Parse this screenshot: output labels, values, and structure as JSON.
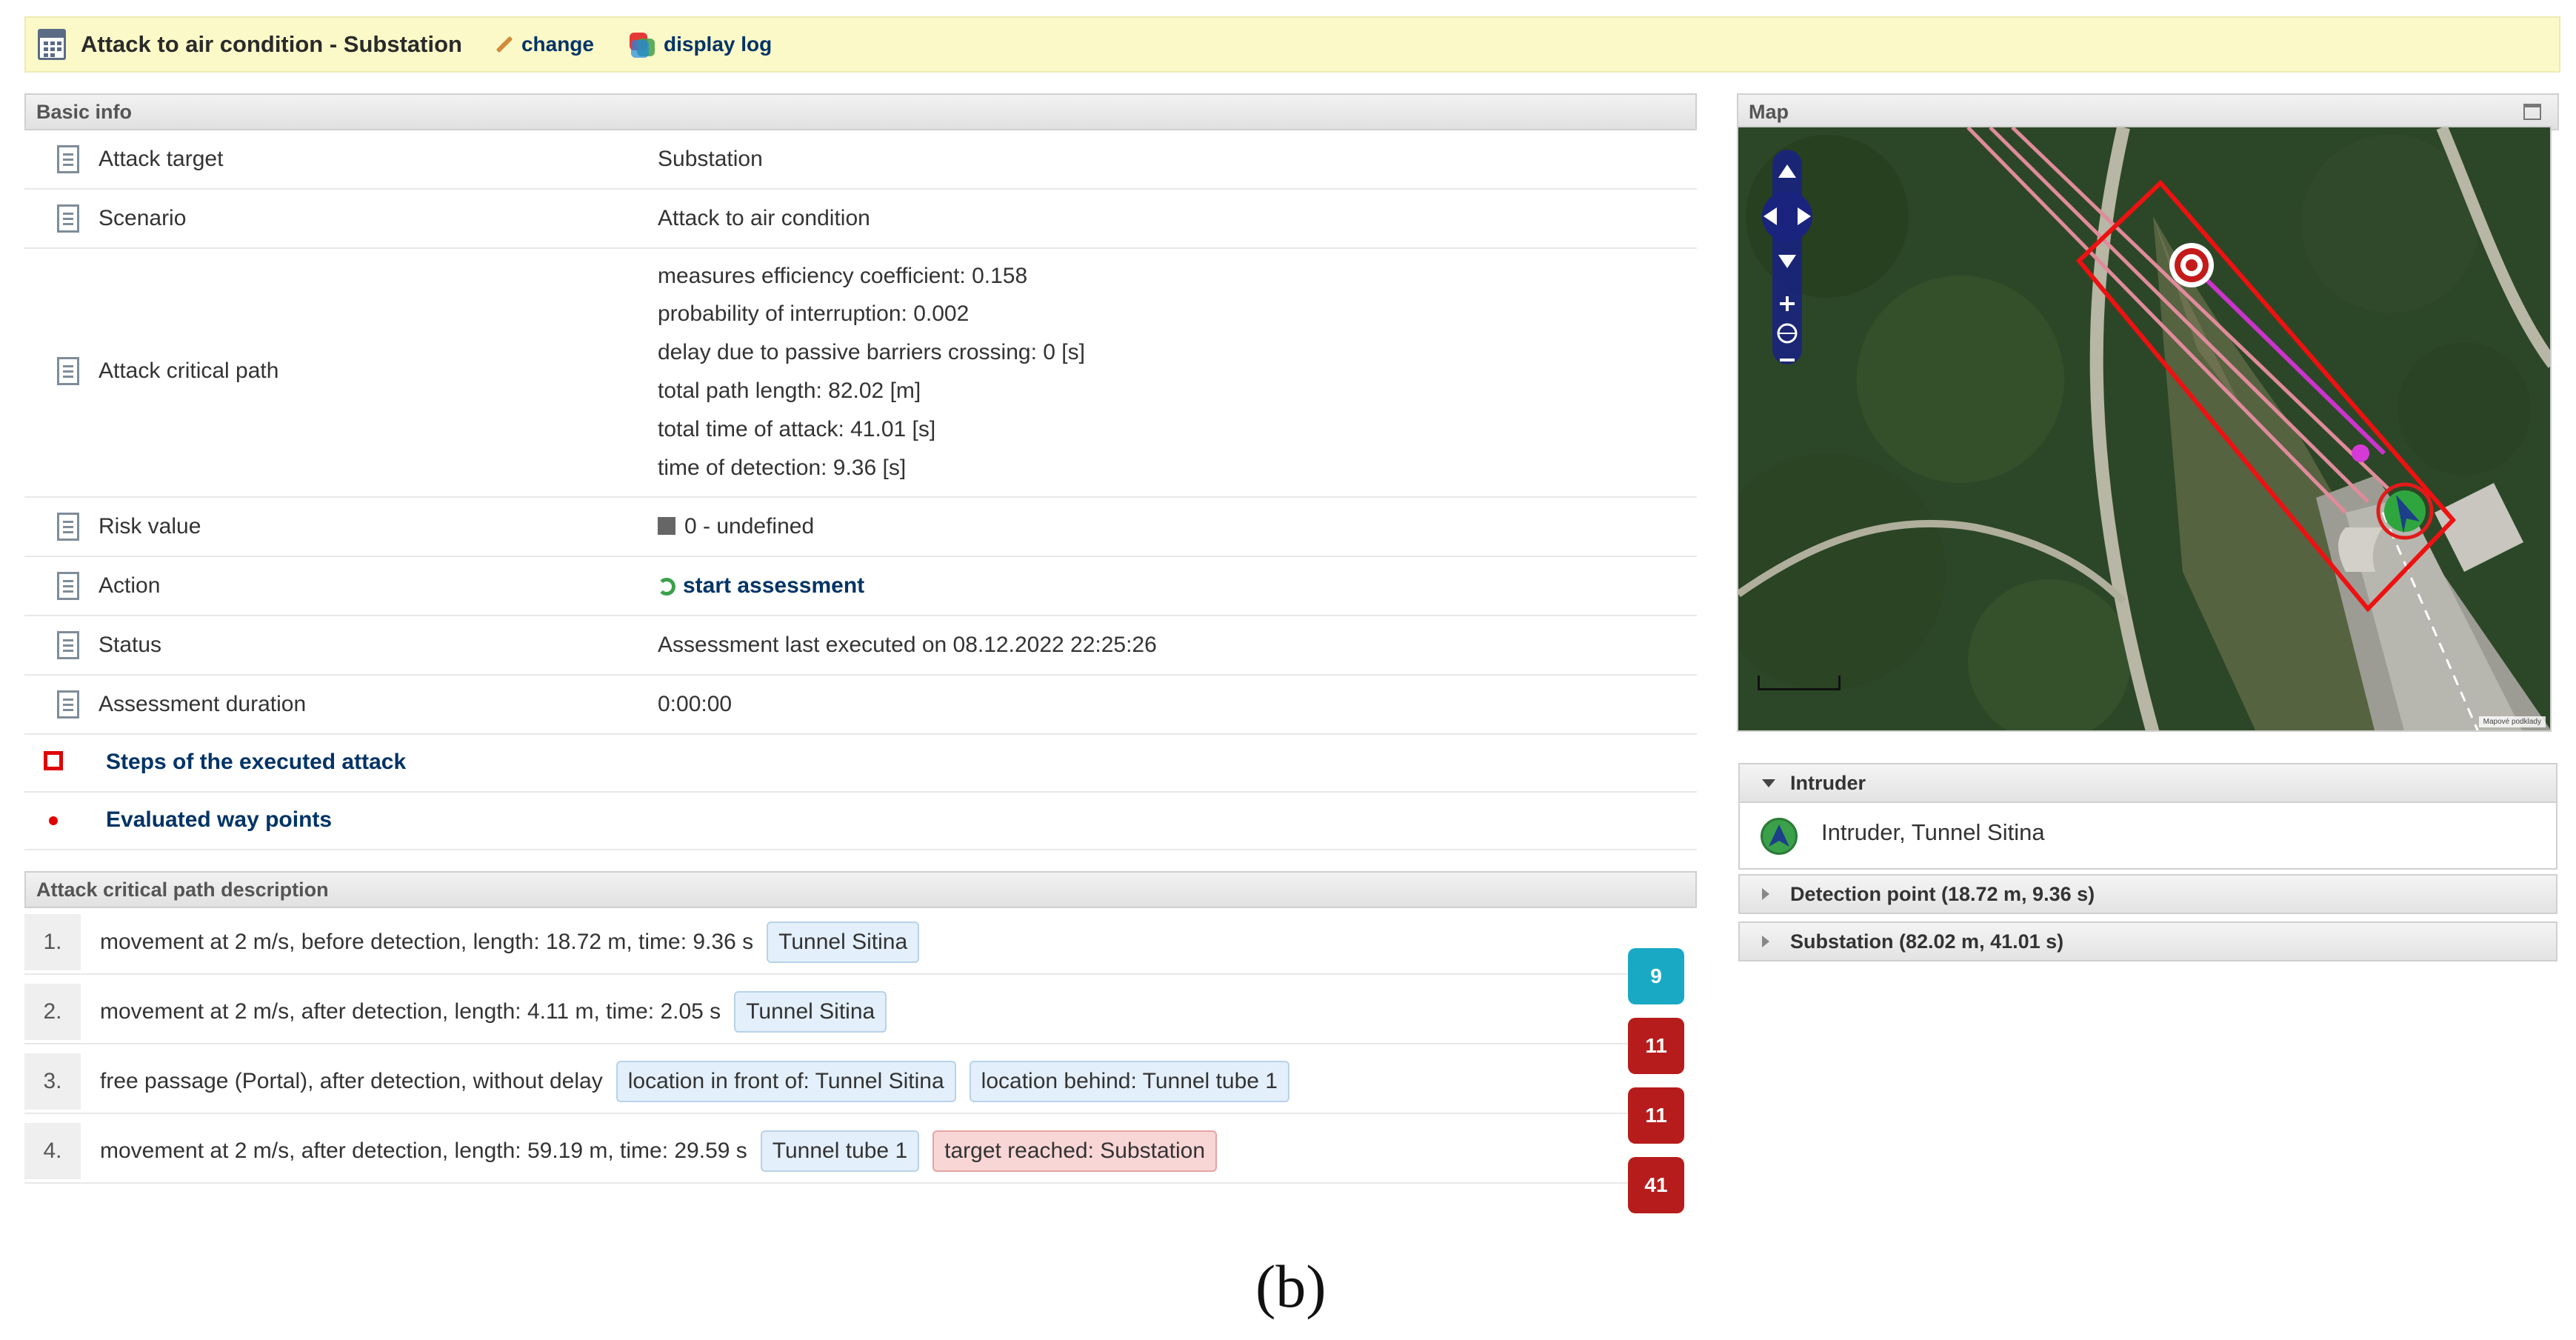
{
  "header": {
    "title": "Attack to air condition - Substation",
    "change_label": "change",
    "display_log_label": "display log"
  },
  "basic_info": {
    "heading": "Basic info",
    "rows": [
      {
        "label": "Attack target",
        "value": "Substation"
      },
      {
        "label": "Scenario",
        "value": "Attack to air condition"
      },
      {
        "label": "Attack critical path",
        "lines": [
          "measures efficiency coefficient: 0.158",
          "probability of interruption: 0.002",
          "delay due to passive barriers crossing: 0 [s]",
          "total path length: 82.02 [m]",
          "total time of attack: 41.01 [s]",
          "time of detection: 9.36 [s]"
        ]
      },
      {
        "label": "Risk value",
        "value": "0 - undefined"
      },
      {
        "label": "Action",
        "value": "start assessment"
      },
      {
        "label": "Status",
        "value": "Assessment last executed on 08.12.2022 22:25:26"
      },
      {
        "label": "Assessment duration",
        "value": "0:00:00"
      }
    ],
    "toggles": [
      "Steps of the executed attack",
      "Evaluated way points"
    ]
  },
  "critical_path": {
    "heading": "Attack critical path description",
    "steps": [
      {
        "num": "1.",
        "text": "movement at 2 m/s, before detection, length: 18.72 m, time: 9.36 s",
        "tags": [
          "Tunnel Sitina"
        ]
      },
      {
        "num": "2.",
        "text": "movement at 2 m/s, after detection, length: 4.11 m, time: 2.05 s",
        "tags": [
          "Tunnel Sitina"
        ]
      },
      {
        "num": "3.",
        "text": "free passage (Portal), after detection, without delay",
        "tags": [
          "location in front of: Tunnel Sitina",
          "location behind: Tunnel tube 1"
        ]
      },
      {
        "num": "4.",
        "text": "movement at 2 m/s, after detection, length: 59.19 m, time: 29.59 s",
        "tags": [
          "Tunnel tube 1"
        ],
        "target_tag": "target reached: Substation"
      }
    ],
    "badges": [
      {
        "value": "9",
        "color": "#19a9c4"
      },
      {
        "value": "11",
        "color": "#b71c1c"
      },
      {
        "value": "11",
        "color": "#b71c1c"
      },
      {
        "value": "41",
        "color": "#b71c1c"
      }
    ]
  },
  "map": {
    "heading": "Map",
    "credit": "Mapové podklady"
  },
  "intruder_panel": {
    "heading": "Intruder",
    "item": "Intruder, Tunnel Sitina",
    "detection_point": "Detection point (18.72 m, 9.36 s)",
    "substation": "Substation (82.02 m, 41.01 s)"
  },
  "caption": "(b)"
}
